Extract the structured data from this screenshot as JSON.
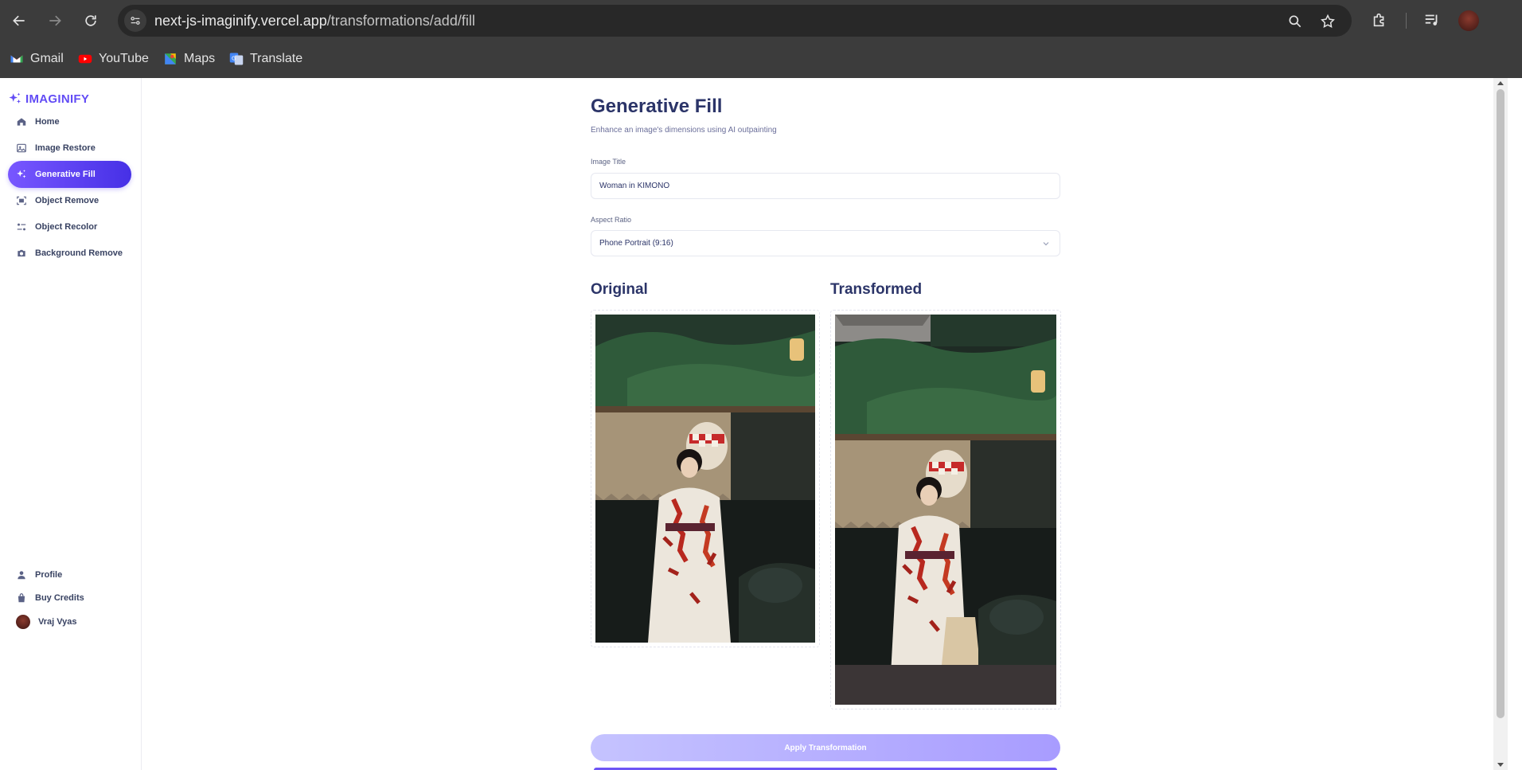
{
  "browser": {
    "url_host": "next-js-imaginify.vercel.app",
    "url_path": "/transformations/add/fill",
    "bookmarks": [
      {
        "label": "Gmail",
        "icon": "gmail-icon"
      },
      {
        "label": "YouTube",
        "icon": "youtube-icon"
      },
      {
        "label": "Maps",
        "icon": "maps-icon"
      },
      {
        "label": "Translate",
        "icon": "translate-icon"
      }
    ]
  },
  "app": {
    "brand": "IMAGINIFY",
    "accent_color": "#624cf5",
    "nav": [
      {
        "label": "Home",
        "icon": "home-icon",
        "active": false
      },
      {
        "label": "Image Restore",
        "icon": "image-icon",
        "active": false
      },
      {
        "label": "Generative Fill",
        "icon": "stars-icon",
        "active": true
      },
      {
        "label": "Object Remove",
        "icon": "scan-icon",
        "active": false
      },
      {
        "label": "Object Recolor",
        "icon": "filter-icon",
        "active": false
      },
      {
        "label": "Background Remove",
        "icon": "camera-icon",
        "active": false
      }
    ],
    "bottom_nav": [
      {
        "label": "Profile",
        "icon": "profile-icon"
      },
      {
        "label": "Buy Credits",
        "icon": "bag-icon"
      }
    ],
    "user_name": "Vraj Vyas"
  },
  "page": {
    "title": "Generative Fill",
    "subtitle": "Enhance an image's dimensions using AI outpainting",
    "image_title_label": "Image Title",
    "image_title_value": "Woman in KIMONO",
    "aspect_ratio_label": "Aspect Ratio",
    "aspect_ratio_value": "Phone Portrait (9:16)",
    "original_heading": "Original",
    "transformed_heading": "Transformed",
    "apply_button": "Apply Transformation"
  }
}
